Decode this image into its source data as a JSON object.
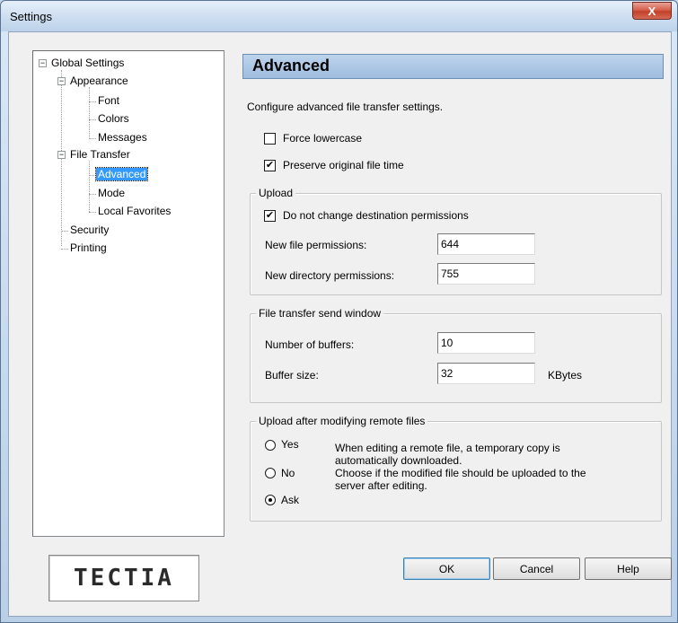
{
  "window": {
    "title": "Settings",
    "close_glyph": "X"
  },
  "tree": {
    "root": "Global Settings",
    "appearance": "Appearance",
    "font": "Font",
    "colors": "Colors",
    "messages": "Messages",
    "file_transfer": "File Transfer",
    "advanced": "Advanced",
    "mode": "Mode",
    "local_favorites": "Local Favorites",
    "security": "Security",
    "printing": "Printing",
    "expander_glyph": "−"
  },
  "logo": {
    "text": "TECTIA"
  },
  "panel": {
    "title": "Advanced",
    "description": "Configure advanced file transfer settings.",
    "force_lowercase": {
      "label": "Force lowercase",
      "checked": false
    },
    "preserve_time": {
      "label": "Preserve original file time",
      "checked": true
    }
  },
  "upload": {
    "legend": "Upload",
    "no_change_perm": {
      "label": "Do not change destination permissions",
      "checked": true
    },
    "file_perm_label": "New file permissions:",
    "file_perm_value": "644",
    "dir_perm_label": "New directory permissions:",
    "dir_perm_value": "755"
  },
  "send_window": {
    "legend": "File transfer send window",
    "buffers_label": "Number of buffers:",
    "buffers_value": "10",
    "size_label": "Buffer size:",
    "size_value": "32",
    "size_unit": "KBytes"
  },
  "upload_after": {
    "legend": "Upload after modifying remote files",
    "options": [
      "Yes",
      "No",
      "Ask"
    ],
    "selected": "Ask",
    "desc_line1": "When editing a remote file, a temporary copy is",
    "desc_line2": "automatically downloaded.",
    "desc_line3": "Choose if the modified file should be uploaded to the",
    "desc_line4": "server after editing."
  },
  "buttons": {
    "ok": "OK",
    "cancel": "Cancel",
    "help": "Help"
  },
  "check_glyph": "✔"
}
